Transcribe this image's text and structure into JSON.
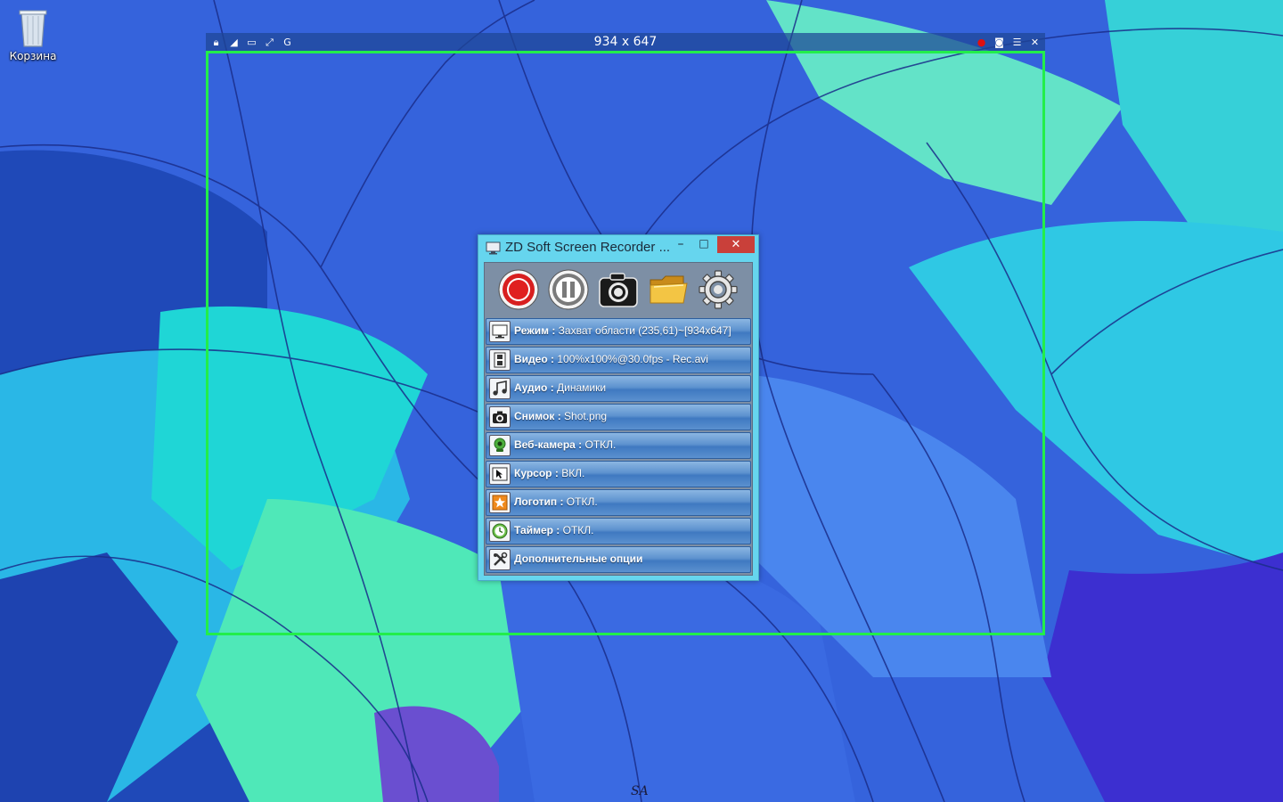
{
  "desktop": {
    "recycle_bin_label": "Корзина",
    "recycle_bin_icon": "recycle-bin-icon"
  },
  "capture": {
    "size_text": "934 x 647",
    "frame_color": "#22ee4a",
    "left_tools": [
      {
        "name": "lock-icon",
        "glyph": "🔒︎"
      },
      {
        "name": "resize-corner-icon",
        "glyph": "◢"
      },
      {
        "name": "window-icon",
        "glyph": "▭"
      },
      {
        "name": "fullscreen-icon",
        "glyph": "⤢"
      },
      {
        "name": "g-icon",
        "glyph": "G"
      }
    ],
    "right_tools": [
      {
        "name": "record-dot-icon",
        "glyph": "●",
        "color": "#e01010"
      },
      {
        "name": "camera-icon",
        "glyph": "◙",
        "color": "#ffffff"
      },
      {
        "name": "list-icon",
        "glyph": "☰",
        "color": "#ffffff"
      },
      {
        "name": "close-icon",
        "glyph": "✕",
        "color": "#ffffff"
      }
    ]
  },
  "recorder": {
    "title": "ZD Soft Screen Recorder ...",
    "minimize": "–",
    "maximize": "□",
    "close": "✕",
    "toolbar": [
      {
        "name": "record-icon"
      },
      {
        "name": "pause-icon"
      },
      {
        "name": "snapshot-camera-icon"
      },
      {
        "name": "folder-icon"
      },
      {
        "name": "settings-gear-icon"
      }
    ],
    "menu": [
      {
        "label": "Режим",
        "value": "Захват области (235,61)~[934x647]",
        "icon": "monitor-icon"
      },
      {
        "label": "Видео",
        "value": "100%x100%@30.0fps - Rec.avi",
        "icon": "film-icon"
      },
      {
        "label": "Аудио",
        "value": "Динамики",
        "icon": "music-note-icon"
      },
      {
        "label": "Снимок",
        "value": "Shot.png",
        "icon": "camera-icon"
      },
      {
        "label": "Веб-камера",
        "value": "ОТКЛ.",
        "icon": "webcam-icon"
      },
      {
        "label": "Курсор",
        "value": "ВКЛ.",
        "icon": "cursor-icon"
      },
      {
        "label": "Логотип",
        "value": "ОТКЛ.",
        "icon": "logo-star-icon"
      },
      {
        "label": "Таймер",
        "value": "ОТКЛ.",
        "icon": "timer-clock-icon"
      },
      {
        "label": "Дополнительные опции",
        "value": "",
        "icon": "tools-icon"
      }
    ]
  },
  "signature": "SA"
}
